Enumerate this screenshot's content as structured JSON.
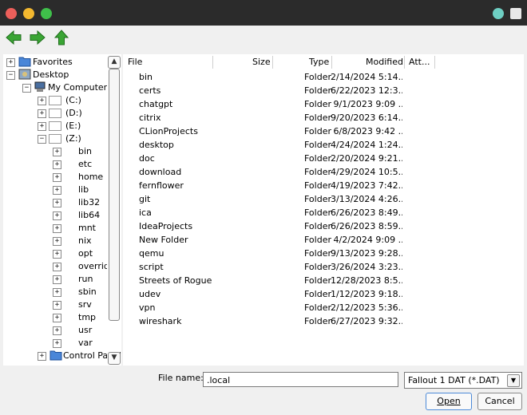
{
  "toolbar": {
    "back_icon": "back-arrow-icon",
    "forward_icon": "forward-arrow-icon",
    "up_icon": "up-arrow-icon"
  },
  "tree": {
    "favorites": "Favorites",
    "desktop": "Desktop",
    "my_computer": "My Computer",
    "drives": [
      "(C:)",
      "(D:)",
      "(E:)",
      "(Z:)"
    ],
    "z_folders": [
      "bin",
      "etc",
      "home",
      "lib",
      "lib32",
      "lib64",
      "mnt",
      "nix",
      "opt",
      "override",
      "run",
      "sbin",
      "srv",
      "tmp",
      "usr",
      "var"
    ],
    "control_panel": "Control Panel"
  },
  "files": {
    "columns": [
      "File",
      "Size",
      "Type",
      "Modified",
      "Att..."
    ],
    "rows": [
      {
        "name": "bin",
        "type": "Folder",
        "modified": "2/14/2024 5:14..."
      },
      {
        "name": "certs",
        "type": "Folder",
        "modified": "6/22/2023 12:3..."
      },
      {
        "name": "chatgpt",
        "type": "Folder",
        "modified": " 9/1/2023 9:09 ..."
      },
      {
        "name": "citrix",
        "type": "Folder",
        "modified": "9/20/2023 6:14..."
      },
      {
        "name": "CLionProjects",
        "type": "Folder",
        "modified": " 6/8/2023 9:42 ..."
      },
      {
        "name": "desktop",
        "type": "Folder",
        "modified": "4/24/2024 1:24..."
      },
      {
        "name": "doc",
        "type": "Folder",
        "modified": "2/20/2024 9:21..."
      },
      {
        "name": "download",
        "type": "Folder",
        "modified": "4/29/2024 10:5..."
      },
      {
        "name": "fernflower",
        "type": "Folder",
        "modified": "4/19/2023 7:42..."
      },
      {
        "name": "git",
        "type": "Folder",
        "modified": "3/13/2024 4:26..."
      },
      {
        "name": "ica",
        "type": "Folder",
        "modified": "6/26/2023 8:49..."
      },
      {
        "name": "IdeaProjects",
        "type": "Folder",
        "modified": "6/26/2023 8:59..."
      },
      {
        "name": "New Folder",
        "type": "Folder",
        "modified": " 4/2/2024 9:09 ..."
      },
      {
        "name": "qemu",
        "type": "Folder",
        "modified": "9/13/2023 9:28..."
      },
      {
        "name": "script",
        "type": "Folder",
        "modified": "3/26/2024 3:23..."
      },
      {
        "name": "Streets of Rogue",
        "type": "Folder",
        "modified": "12/28/2023 8:5..."
      },
      {
        "name": "udev",
        "type": "Folder",
        "modified": "1/12/2023 9:18..."
      },
      {
        "name": "vpn",
        "type": "Folder",
        "modified": "2/12/2023 5:36..."
      },
      {
        "name": "wireshark",
        "type": "Folder",
        "modified": "6/27/2023 9:32..."
      }
    ]
  },
  "footer": {
    "filename_label": "File name:",
    "filename_value": ".local",
    "filetype": "Fallout 1 DAT (*.DAT)",
    "open_label": "Open",
    "cancel_label": "Cancel"
  },
  "colors": {
    "folder": "#4a86d8",
    "arrows": "#3aa534"
  }
}
